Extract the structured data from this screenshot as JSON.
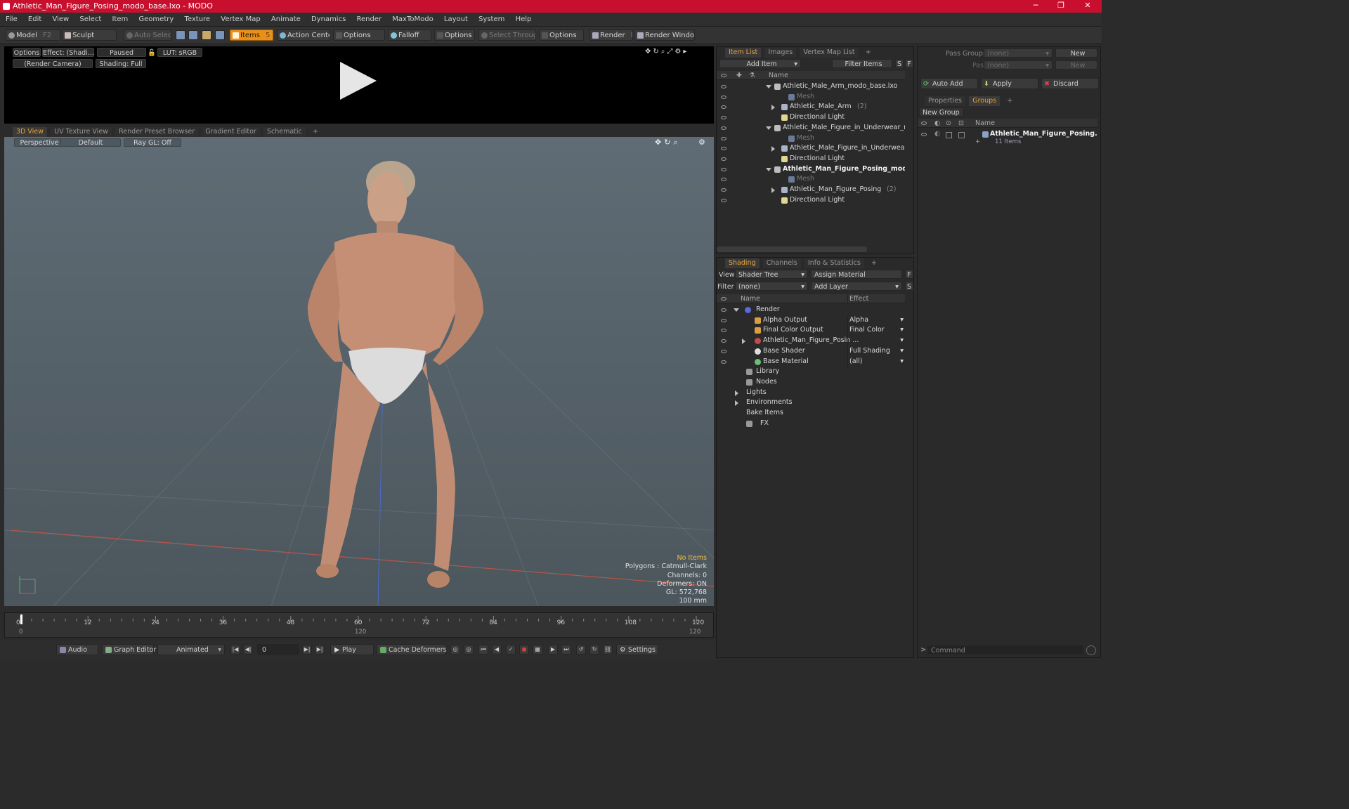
{
  "window": {
    "title": "Athletic_Man_Figure_Posing_modo_base.lxo - MODO",
    "min": "─",
    "max": "❐",
    "close": "✕"
  },
  "menu": [
    "File",
    "Edit",
    "View",
    "Select",
    "Item",
    "Geometry",
    "Texture",
    "Vertex Map",
    "Animate",
    "Dynamics",
    "Render",
    "MaxToModo",
    "Layout",
    "System",
    "Help"
  ],
  "toolbar": {
    "model": "Model",
    "model_key": "F2",
    "sculpt": "Sculpt",
    "auto_select": "Auto Select",
    "items": "Items",
    "items_key": "5",
    "action_center": "Action Center",
    "options1": "Options",
    "falloff": "Falloff",
    "options2": "Options",
    "select_through": "Select Through",
    "options3": "Options",
    "render": "Render",
    "render_key": "F9",
    "render_window": "Render Window"
  },
  "render_view": {
    "options": "Options",
    "effect": "Effect: (Shadi...",
    "paused": "Paused",
    "lut": "LUT: sRGB",
    "camera": "(Render Camera)",
    "shading": "Shading: Full"
  },
  "view_tabs": [
    "3D View",
    "UV Texture View",
    "Render Preset Browser",
    "Gradient Editor",
    "Schematic"
  ],
  "viewport": {
    "projection": "Perspective",
    "style": "Default",
    "raygl": "Ray GL: Off",
    "stats": {
      "items": "No Items",
      "polygons": "Polygons : Catmull-Clark",
      "channels": "Channels: 0",
      "deformers": "Deformers: ON",
      "gl": "GL: 572,768",
      "scale": "100 mm"
    }
  },
  "timeline": {
    "ticks": [
      "0",
      "12",
      "24",
      "36",
      "48",
      "60",
      "72",
      "84",
      "96",
      "108",
      "120"
    ],
    "start": "0",
    "mid": "120",
    "end": "120"
  },
  "bottom": {
    "audio": "Audio",
    "graph_editor": "Graph Editor",
    "animated": "Animated",
    "frame": "0",
    "play": "Play",
    "cache": "Cache Deformers",
    "settings": "Settings"
  },
  "item_list": {
    "tabs": [
      "Item List",
      "Images",
      "Vertex Map List"
    ],
    "add_item": "Add Item",
    "filter": "Filter Items",
    "s": "S",
    "f": "F",
    "col_name": "Name",
    "rows": [
      {
        "label": "Athletic_Male_Arm_modo_base.lxo",
        "indent": 0,
        "kind": "scene"
      },
      {
        "label": "Mesh",
        "indent": 2,
        "kind": "mesh"
      },
      {
        "label": "Athletic_Male_Arm",
        "count": "(2)",
        "indent": 1,
        "kind": "group"
      },
      {
        "label": "Directional Light",
        "indent": 1,
        "kind": "light"
      },
      {
        "label": "Athletic_Male_Figure_in_Underwear_mo ...",
        "indent": 0,
        "kind": "scene"
      },
      {
        "label": "Mesh",
        "indent": 2,
        "kind": "mesh"
      },
      {
        "label": "Athletic_Male_Figure_in_Underwear",
        "count": "(2)",
        "indent": 1,
        "kind": "group"
      },
      {
        "label": "Directional Light",
        "indent": 1,
        "kind": "light"
      },
      {
        "label": "Athletic_Man_Figure_Posing_mod ...",
        "indent": 0,
        "kind": "scene-bold"
      },
      {
        "label": "Mesh",
        "indent": 2,
        "kind": "mesh"
      },
      {
        "label": "Athletic_Man_Figure_Posing",
        "count": "(2)",
        "indent": 1,
        "kind": "group"
      },
      {
        "label": "Directional Light",
        "indent": 1,
        "kind": "light"
      }
    ]
  },
  "shading": {
    "tabs": [
      "Shading",
      "Channels",
      "Info & Statistics"
    ],
    "view_label": "View",
    "view_value": "Shader Tree",
    "assign_material": "Assign Material",
    "f": "F",
    "filter_label": "Filter",
    "filter_value": "(none)",
    "add_layer": "Add Layer",
    "s": "S",
    "col_name": "Name",
    "col_effect": "Effect",
    "rows": [
      {
        "label": "Render",
        "effect": "",
        "indent": 0
      },
      {
        "label": "Alpha Output",
        "effect": "Alpha",
        "indent": 1
      },
      {
        "label": "Final Color Output",
        "effect": "Final Color",
        "indent": 1
      },
      {
        "label": "Athletic_Man_Figure_Posin ...",
        "effect": "",
        "indent": 1
      },
      {
        "label": "Base Shader",
        "effect": "Full Shading",
        "indent": 1
      },
      {
        "label": "Base Material",
        "effect": "(all)",
        "indent": 1
      },
      {
        "label": "Library",
        "effect": "",
        "indent": 1
      },
      {
        "label": "Nodes",
        "effect": "",
        "indent": 1
      },
      {
        "label": "Lights",
        "effect": "",
        "indent": 0
      },
      {
        "label": "Environments",
        "effect": "",
        "indent": 0
      },
      {
        "label": "Bake Items",
        "effect": "",
        "indent": 0
      },
      {
        "label": "FX",
        "effect": "",
        "indent": 0
      }
    ]
  },
  "right": {
    "pass_groups": "Pass Groups",
    "pass_groups_value": "(none)",
    "new": "New",
    "passes": "Passes",
    "passes_value": "(none)",
    "new2": "New",
    "auto_add": "Auto Add",
    "apply": "Apply",
    "discard": "Discard",
    "tabs": [
      "Properties",
      "Groups"
    ],
    "new_group": "New Group",
    "col_name": "Name",
    "group_name": "Athletic_Man_Figure_Posing...",
    "group_items": "11 Items",
    "command": "Command"
  },
  "colors": {
    "accent": "#e8a33a",
    "title_bar": "#c8102e",
    "items_btn": "#e8901c"
  }
}
